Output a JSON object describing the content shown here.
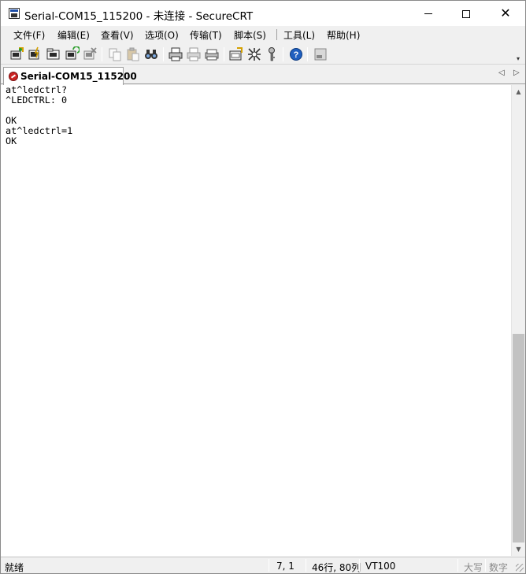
{
  "window": {
    "title": "Serial-COM15_115200 - 未连接 - SecureCRT",
    "controls": {
      "minimize": "minimize",
      "maximize": "maximize",
      "close": "✕"
    }
  },
  "menu": {
    "items": [
      {
        "label": "文件(F)"
      },
      {
        "label": "编辑(E)"
      },
      {
        "label": "查看(V)"
      },
      {
        "label": "选项(O)"
      },
      {
        "label": "传输(T)"
      },
      {
        "label": "脚本(S)"
      },
      {
        "label": "工具(L)"
      },
      {
        "label": "帮助(H)"
      }
    ]
  },
  "toolbar": {
    "icons": [
      "connect-icon",
      "quick-connect-icon",
      "connect-in-tab-icon",
      "reconnect-icon",
      "disconnect-icon",
      "copy-icon",
      "paste-icon",
      "find-icon",
      "print-icon",
      "print-selection-icon",
      "print-setup-icon",
      "session-options-icon",
      "global-options-icon",
      "keymap-icon",
      "help-icon",
      "minimize-toolbar-icon"
    ],
    "overflow": "▾"
  },
  "tabs": {
    "items": [
      {
        "label": "Serial-COM15_115200",
        "status": "disconnected"
      }
    ],
    "nav_left": "◁",
    "nav_right": "▷"
  },
  "terminal": {
    "lines": [
      "at^ledctrl?",
      "^LEDCTRL: 0",
      "",
      "OK",
      "at^ledctrl=1",
      "OK"
    ]
  },
  "scrollbar": {
    "up": "▲",
    "down": "▼",
    "position": 0.53,
    "visible_fraction": 0.47
  },
  "statusbar": {
    "status": "就绪",
    "cursor": "7,  1",
    "dimensions": "46行, 80列",
    "emulation": "VT100",
    "caps": "大写",
    "num": "数字"
  },
  "colors": {
    "accent_red": "#cc2222",
    "help_blue": "#1f5fbf"
  }
}
